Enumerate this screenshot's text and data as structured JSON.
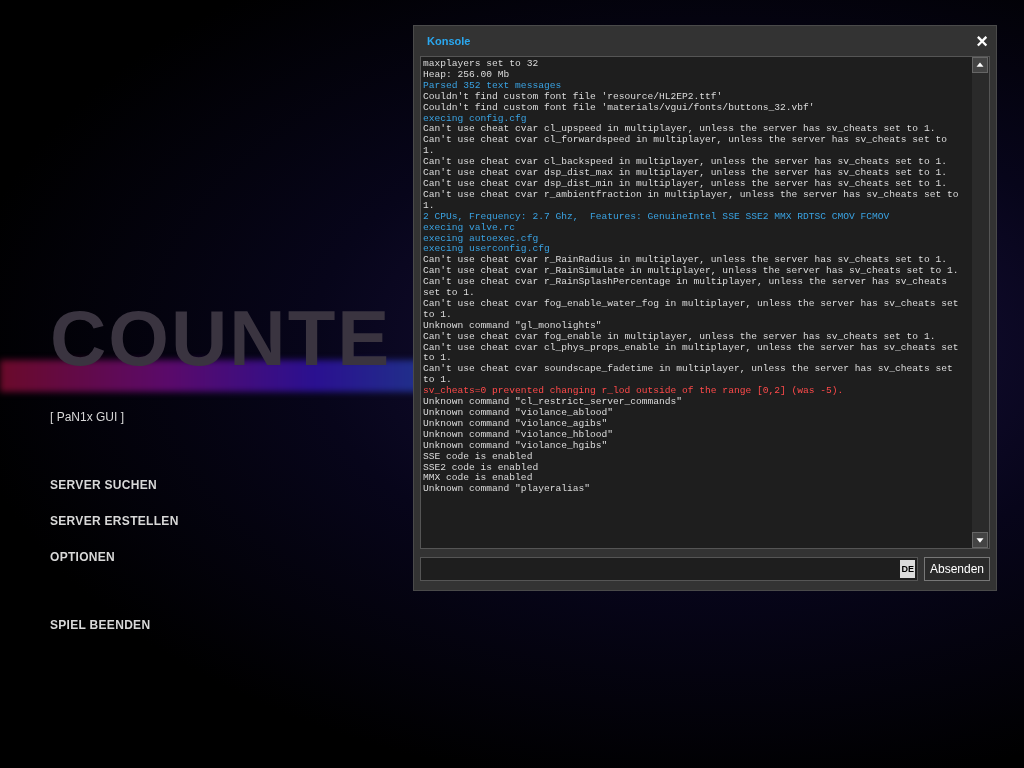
{
  "background": {
    "logo": "COUNTE"
  },
  "menu": {
    "title": "[ PaN1x GUI ]",
    "items": [
      {
        "label": "SERVER SUCHEN"
      },
      {
        "label": "SERVER ERSTELLEN"
      },
      {
        "label": "OPTIONEN"
      }
    ],
    "exit_items": [
      {
        "label": "SPIEL BEENDEN"
      }
    ]
  },
  "console": {
    "title": "Konsole",
    "close": "×",
    "lines": [
      {
        "kind": "normal",
        "text": "maxplayers set to 32"
      },
      {
        "kind": "normal",
        "text": "Heap: 256.00 Mb"
      },
      {
        "kind": "info",
        "text": "Parsed 352 text messages"
      },
      {
        "kind": "normal",
        "text": "Couldn't find custom font file 'resource/HL2EP2.ttf'"
      },
      {
        "kind": "normal",
        "text": "Couldn't find custom font file 'materials/vgui/fonts/buttons_32.vbf'"
      },
      {
        "kind": "info",
        "text": "execing config.cfg"
      },
      {
        "kind": "normal",
        "text": "Can't use cheat cvar cl_upspeed in multiplayer, unless the server has sv_cheats set to 1."
      },
      {
        "kind": "normal",
        "text": "Can't use cheat cvar cl_forwardspeed in multiplayer, unless the server has sv_cheats set to 1."
      },
      {
        "kind": "normal",
        "text": "Can't use cheat cvar cl_backspeed in multiplayer, unless the server has sv_cheats set to 1."
      },
      {
        "kind": "normal",
        "text": "Can't use cheat cvar dsp_dist_max in multiplayer, unless the server has sv_cheats set to 1."
      },
      {
        "kind": "normal",
        "text": "Can't use cheat cvar dsp_dist_min in multiplayer, unless the server has sv_cheats set to 1."
      },
      {
        "kind": "normal",
        "text": "Can't use cheat cvar r_ambientfraction in multiplayer, unless the server has sv_cheats set to 1."
      },
      {
        "kind": "info",
        "text": "2 CPUs, Frequency: 2.7 Ghz,  Features: GenuineIntel SSE SSE2 MMX RDTSC CMOV FCMOV"
      },
      {
        "kind": "info",
        "text": "execing valve.rc"
      },
      {
        "kind": "info",
        "text": "execing autoexec.cfg"
      },
      {
        "kind": "info",
        "text": "execing userconfig.cfg"
      },
      {
        "kind": "normal",
        "text": "Can't use cheat cvar r_RainRadius in multiplayer, unless the server has sv_cheats set to 1."
      },
      {
        "kind": "normal",
        "text": "Can't use cheat cvar r_RainSimulate in multiplayer, unless the server has sv_cheats set to 1."
      },
      {
        "kind": "normal",
        "text": "Can't use cheat cvar r_RainSplashPercentage in multiplayer, unless the server has sv_cheats set to 1."
      },
      {
        "kind": "normal",
        "text": "Can't use cheat cvar fog_enable_water_fog in multiplayer, unless the server has sv_cheats set to 1."
      },
      {
        "kind": "normal",
        "text": "Unknown command \"gl_monolights\""
      },
      {
        "kind": "normal",
        "text": "Can't use cheat cvar fog_enable in multiplayer, unless the server has sv_cheats set to 1."
      },
      {
        "kind": "normal",
        "text": "Can't use cheat cvar cl_phys_props_enable in multiplayer, unless the server has sv_cheats set to 1."
      },
      {
        "kind": "normal",
        "text": "Can't use cheat cvar soundscape_fadetime in multiplayer, unless the server has sv_cheats set to 1."
      },
      {
        "kind": "error",
        "text": "sv_cheats=0 prevented changing r_lod outside of the range [0,2] (was -5)."
      },
      {
        "kind": "normal",
        "text": "Unknown command \"cl_restrict_server_commands\""
      },
      {
        "kind": "normal",
        "text": "Unknown command \"violance_ablood\""
      },
      {
        "kind": "normal",
        "text": "Unknown command \"violance_agibs\""
      },
      {
        "kind": "normal",
        "text": "Unknown command \"violance_hblood\""
      },
      {
        "kind": "normal",
        "text": "Unknown command \"violance_hgibs\""
      },
      {
        "kind": "normal",
        "text": "SSE code is enabled"
      },
      {
        "kind": "normal",
        "text": "SSE2 code is enabled"
      },
      {
        "kind": "normal",
        "text": "MMX code is enabled"
      },
      {
        "kind": "normal",
        "text": "Unknown command \"playeralias\""
      }
    ],
    "input_language": "DE",
    "submit": "Absenden"
  }
}
